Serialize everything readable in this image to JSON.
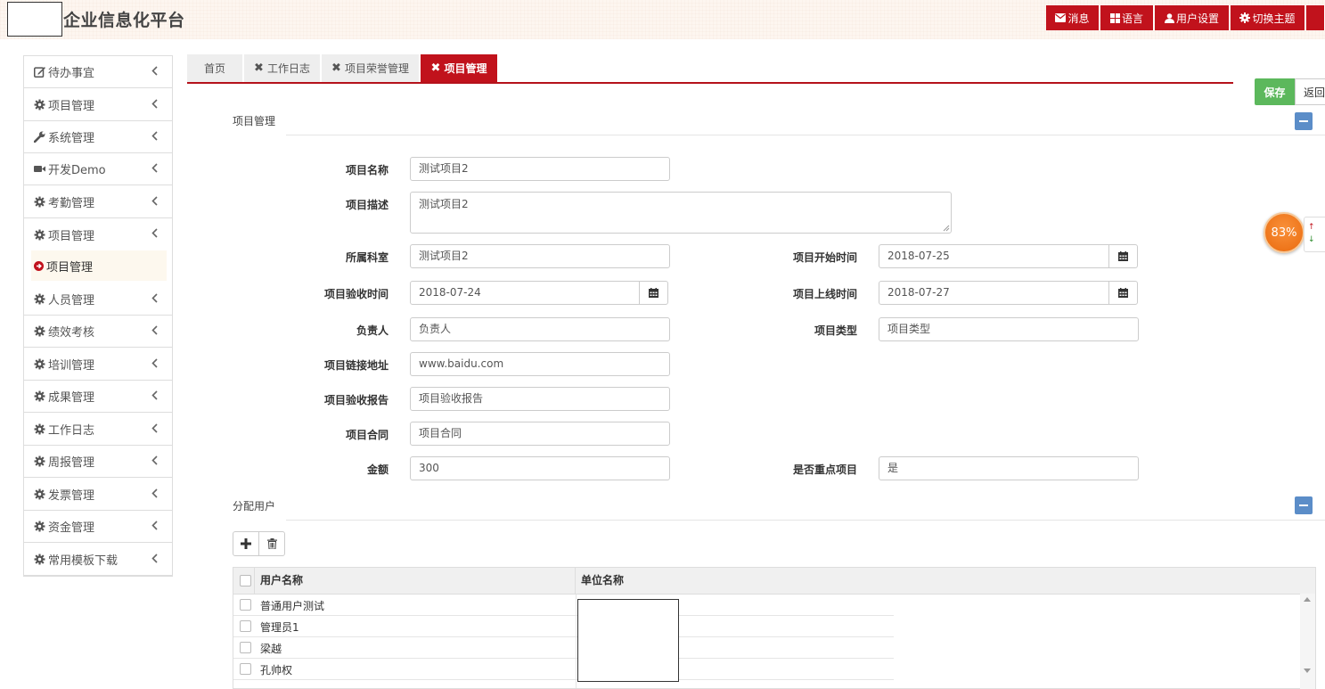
{
  "header": {
    "app_title": "企业信息化平台",
    "buttons": [
      {
        "label": "消息",
        "icon": "envelope-icon"
      },
      {
        "label": "语言",
        "icon": "grid-icon"
      },
      {
        "label": "用户设置",
        "icon": "user-icon"
      },
      {
        "label": "切换主题",
        "icon": "gear-icon"
      }
    ],
    "accent_color": "#c1121c"
  },
  "sidebar": {
    "items": [
      {
        "label": "待办事宜",
        "icon": "edit-icon"
      },
      {
        "label": "项目管理",
        "icon": "gear-icon"
      },
      {
        "label": "系统管理",
        "icon": "wrench-icon"
      },
      {
        "label": "开发Demo",
        "icon": "video-icon"
      },
      {
        "label": "考勤管理",
        "icon": "gear-icon"
      },
      {
        "label": "项目管理",
        "icon": "gear-icon",
        "expanded": true
      },
      {
        "label": "人员管理",
        "icon": "gear-icon"
      },
      {
        "label": "绩效考核",
        "icon": "gear-icon"
      },
      {
        "label": "培训管理",
        "icon": "gear-icon"
      },
      {
        "label": "成果管理",
        "icon": "gear-icon"
      },
      {
        "label": "工作日志",
        "icon": "gear-icon"
      },
      {
        "label": "周报管理",
        "icon": "gear-icon"
      },
      {
        "label": "发票管理",
        "icon": "gear-icon"
      },
      {
        "label": "资金管理",
        "icon": "gear-icon"
      },
      {
        "label": "常用模板下载",
        "icon": "gear-icon"
      }
    ],
    "sub_item": {
      "label": "项目管理",
      "icon": "arrow-circle-right-icon"
    }
  },
  "tabs": [
    {
      "label": "首页",
      "closable": false,
      "active": false
    },
    {
      "label": "工作日志",
      "closable": true,
      "active": false
    },
    {
      "label": "项目荣誉管理",
      "closable": true,
      "active": false
    },
    {
      "label": "项目管理",
      "closable": true,
      "active": true
    }
  ],
  "actions": {
    "save": "保存",
    "back": "返回"
  },
  "section1": {
    "title": "项目管理"
  },
  "form": {
    "name": {
      "label": "项目名称",
      "value": "测试项目2"
    },
    "desc": {
      "label": "项目描述",
      "value": "测试项目2"
    },
    "dept": {
      "label": "所属科室",
      "value": "测试项目2"
    },
    "start": {
      "label": "项目开始时间",
      "value": "2018-07-25"
    },
    "accept": {
      "label": "项目验收时间",
      "value": "2018-07-24"
    },
    "online": {
      "label": "项目上线时间",
      "value": "2018-07-27"
    },
    "owner": {
      "label": "负责人",
      "value": "负责人"
    },
    "type": {
      "label": "项目类型",
      "value": "项目类型"
    },
    "link": {
      "label": "项目链接地址",
      "value": "www.baidu.com"
    },
    "report": {
      "label": "项目验收报告",
      "value": "项目验收报告"
    },
    "contract": {
      "label": "项目合同",
      "value": "项目合同"
    },
    "amount": {
      "label": "金额",
      "value": "300"
    },
    "key": {
      "label": "是否重点项目",
      "value": "是"
    }
  },
  "section2": {
    "title": "分配用户"
  },
  "table": {
    "headers": [
      "用户名称",
      "单位名称"
    ],
    "rows": [
      "普通用户测试",
      "管理员1",
      "梁越",
      "孔帅权"
    ]
  },
  "badge": {
    "value": "83%"
  }
}
